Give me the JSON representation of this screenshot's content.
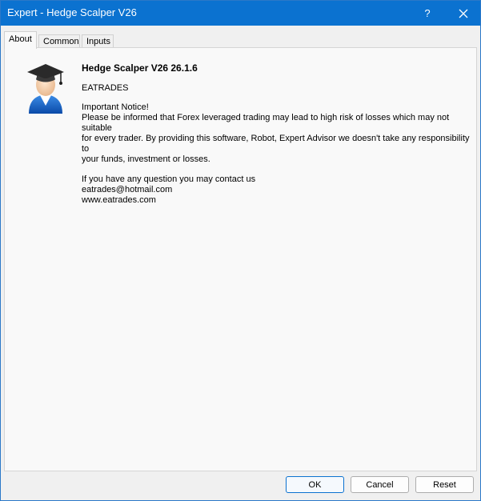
{
  "window": {
    "title": "Expert - Hedge Scalper V26",
    "help_label": "?",
    "close_icon": "close-icon"
  },
  "tabs": [
    {
      "label": "About",
      "active": true
    },
    {
      "label": "Common",
      "active": false
    },
    {
      "label": "Inputs",
      "active": false
    }
  ],
  "about": {
    "icon": "graduate-avatar-icon",
    "heading": "Hedge Scalper V26 26.1.6",
    "company": "EATRADES",
    "notice_title": "Important Notice!",
    "notice_line1": "Please be informed that Forex leveraged trading may lead to high risk of losses which may not suitable",
    "notice_line2": "for every trader. By providing this software, Robot, Expert Advisor we doesn't take any responsibility to",
    "notice_line3": "your funds, investment or losses.",
    "contact_intro": "If you have any question you may contact us",
    "email": "eatrades@hotmail.com",
    "website": "www.eatrades.com"
  },
  "buttons": {
    "ok": "OK",
    "cancel": "Cancel",
    "reset": "Reset"
  },
  "colors": {
    "titlebar": "#0b72d0",
    "accent": "#0b72d0"
  }
}
